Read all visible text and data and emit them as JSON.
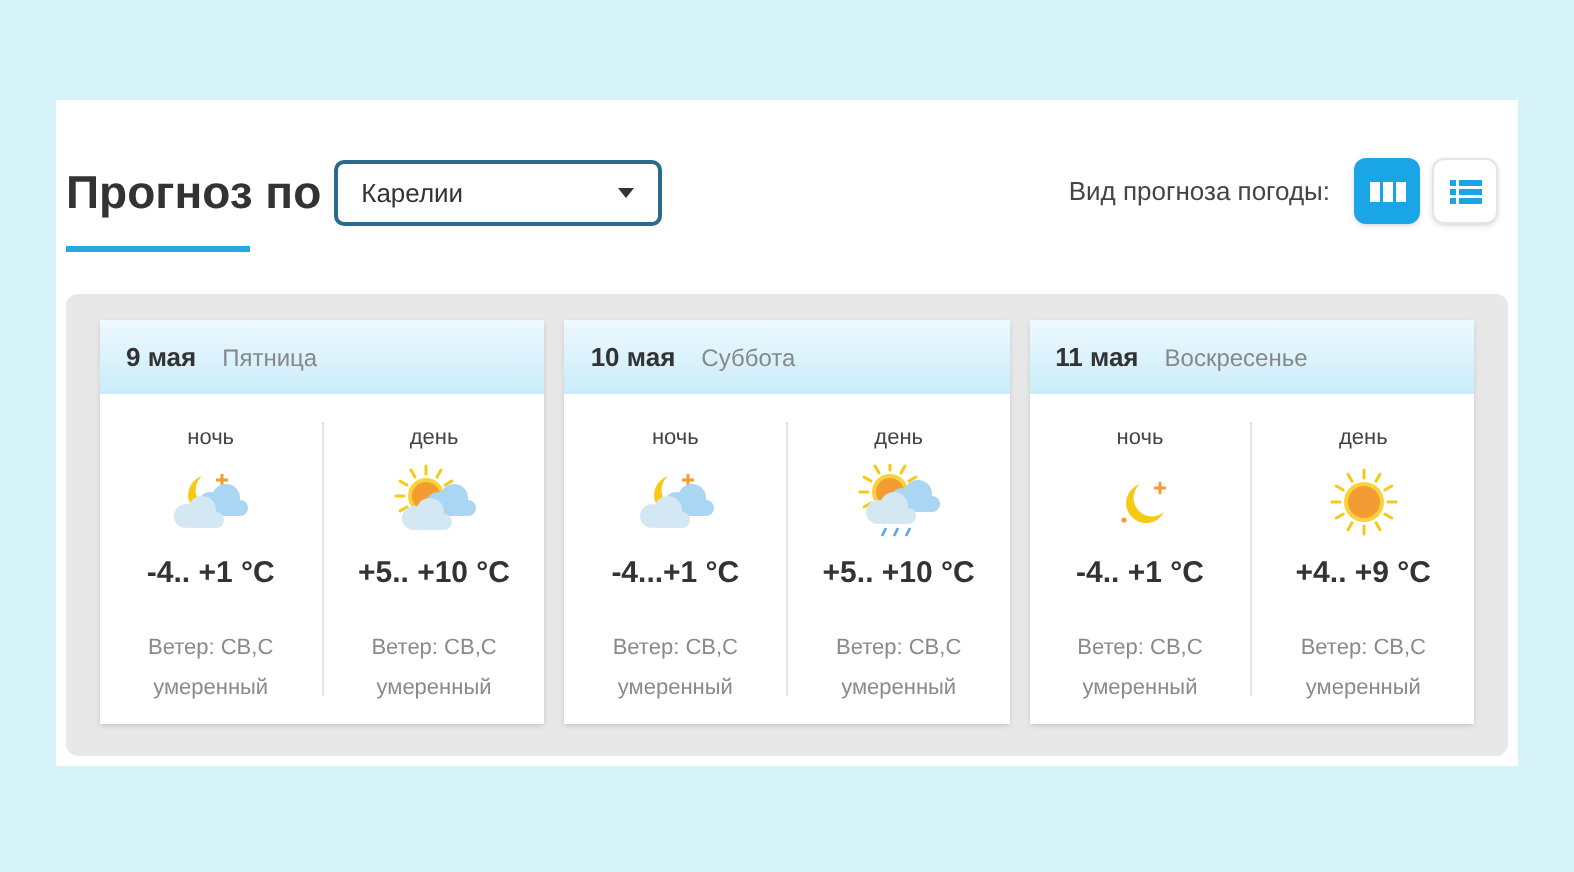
{
  "header": {
    "title": "Прогноз по",
    "region_select": {
      "value": "Карелии"
    },
    "view_label": "Вид прогноза погоды:",
    "view_buttons": [
      {
        "kind": "columns",
        "selected": true
      },
      {
        "kind": "list",
        "selected": false
      }
    ]
  },
  "days": [
    {
      "date": "9 мая",
      "weekday": "Пятница",
      "periods": [
        {
          "label": "ночь",
          "kind": "moon-cloud",
          "temp": "-4.. +1 °C",
          "wind": "Ветер: СВ,С",
          "wind_strength": "умеренный"
        },
        {
          "label": "день",
          "kind": "sun-cloud",
          "temp": "+5.. +10 °C",
          "wind": "Ветер: СВ,С",
          "wind_strength": "умеренный"
        }
      ]
    },
    {
      "date": "10 мая",
      "weekday": "Суббота",
      "periods": [
        {
          "label": "ночь",
          "kind": "moon-cloud",
          "temp": "-4...+1 °C",
          "wind": "Ветер: СВ,С",
          "wind_strength": "умеренный"
        },
        {
          "label": "день",
          "kind": "sun-cloud-rain",
          "temp": "+5.. +10 °C",
          "wind": "Ветер: СВ,С",
          "wind_strength": "умеренный"
        }
      ]
    },
    {
      "date": "11 мая",
      "weekday": "Воскресенье",
      "periods": [
        {
          "label": "ночь",
          "kind": "moon",
          "temp": "-4.. +1 °C",
          "wind": "Ветер: СВ,С",
          "wind_strength": "умеренный"
        },
        {
          "label": "день",
          "kind": "sun",
          "temp": "+4.. +9 °C",
          "wind": "Ветер: СВ,С",
          "wind_strength": "умеренный"
        }
      ]
    }
  ]
}
